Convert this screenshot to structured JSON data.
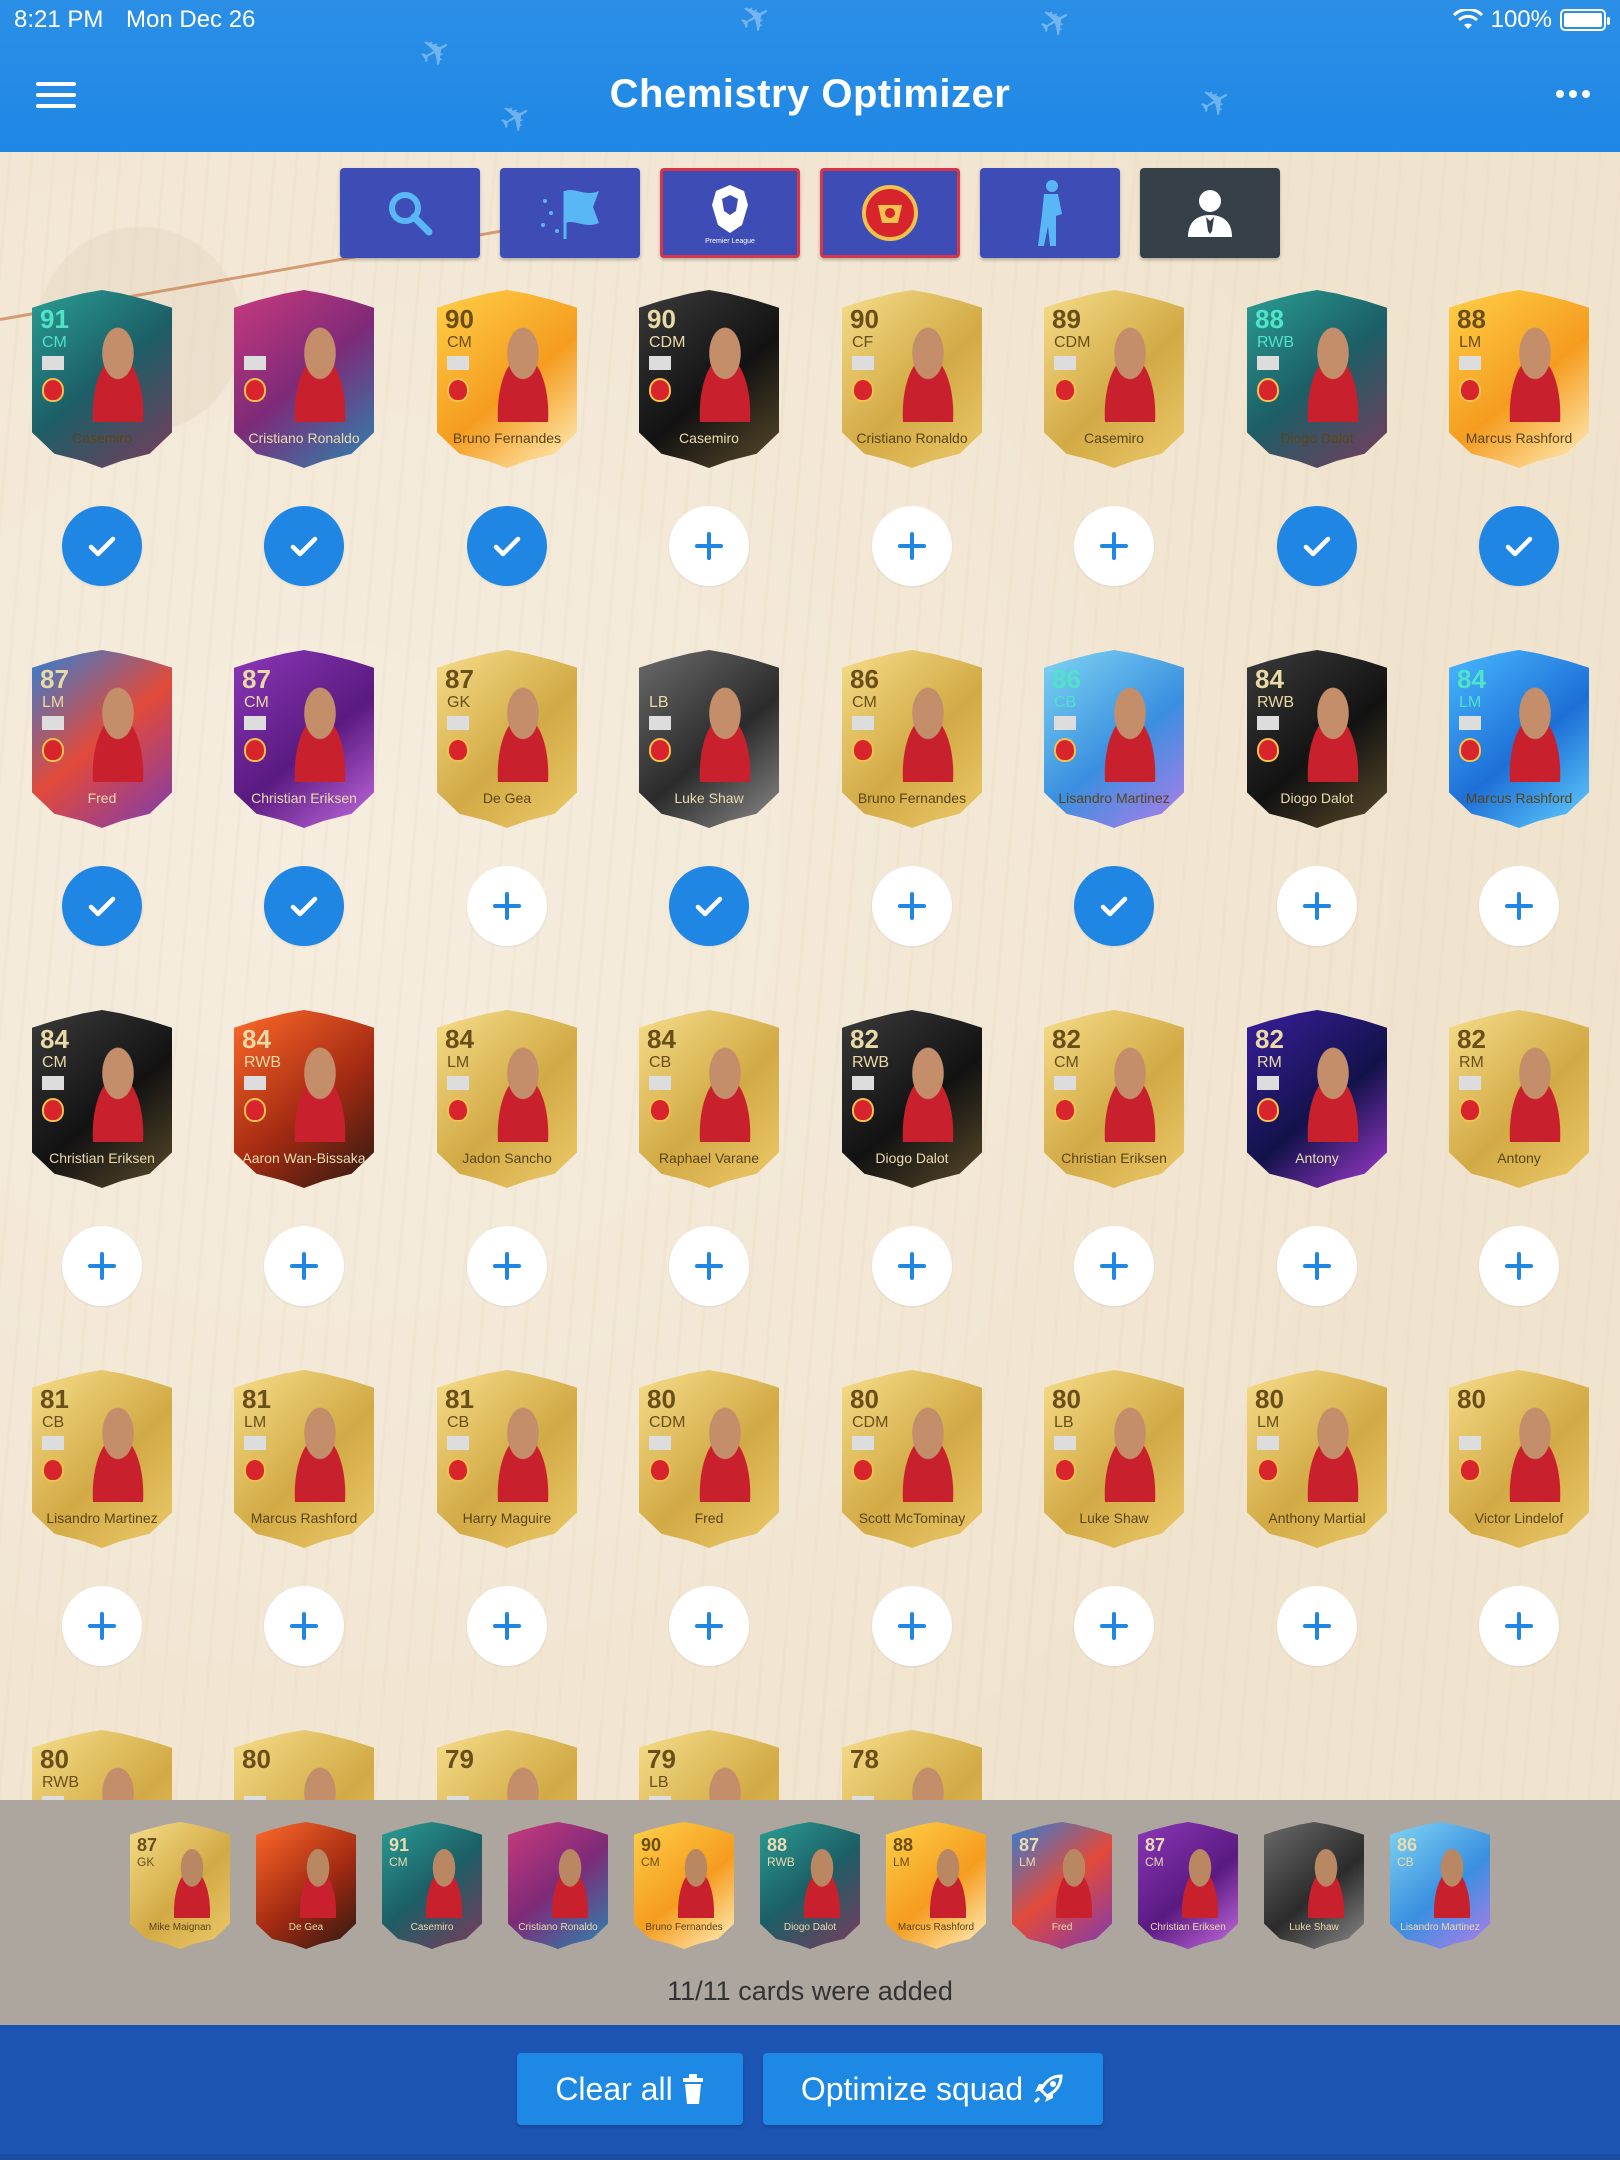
{
  "status_bar": {
    "time": "8:21 PM",
    "date": "Mon Dec 26",
    "battery": "100%"
  },
  "header": {
    "title": "Chemistry Optimizer"
  },
  "filters": [
    {
      "name": "search-filter",
      "icon": "search-icon",
      "selected": false
    },
    {
      "name": "nation-filter",
      "icon": "flag-icon",
      "selected": false
    },
    {
      "name": "league-filter",
      "icon": "premier-league-icon",
      "selected": true
    },
    {
      "name": "club-filter",
      "icon": "manchester-united-icon",
      "selected": true
    },
    {
      "name": "position-filter",
      "icon": "player-icon",
      "selected": false
    },
    {
      "name": "manager-filter",
      "icon": "manager-icon",
      "selected": false
    }
  ],
  "cards": [
    {
      "rating": "91",
      "pos": "CM",
      "name": "Casemiro",
      "style": "teal",
      "added": true
    },
    {
      "rating": "",
      "pos": "",
      "name": "Cristiano Ronaldo",
      "style": "pink",
      "added": true
    },
    {
      "rating": "90",
      "pos": "CM",
      "name": "Bruno Fernandes",
      "style": "orange",
      "added": true
    },
    {
      "rating": "90",
      "pos": "CDM",
      "name": "Casemiro",
      "style": "black",
      "added": false
    },
    {
      "rating": "90",
      "pos": "CF",
      "name": "Cristiano Ronaldo",
      "style": "gold",
      "added": false
    },
    {
      "rating": "89",
      "pos": "CDM",
      "name": "Casemiro",
      "style": "gold",
      "added": false
    },
    {
      "rating": "88",
      "pos": "RWB",
      "name": "Diogo Dalot",
      "style": "teal",
      "added": true
    },
    {
      "rating": "88",
      "pos": "LM",
      "name": "Marcus Rashford",
      "style": "orange",
      "added": true
    },
    {
      "rating": "87",
      "pos": "LM",
      "name": "Fred",
      "style": "fred",
      "added": true
    },
    {
      "rating": "87",
      "pos": "CM",
      "name": "Christian Eriksen",
      "style": "purple",
      "added": true
    },
    {
      "rating": "87",
      "pos": "GK",
      "name": "De Gea",
      "style": "gold",
      "added": false
    },
    {
      "rating": "",
      "pos": "LB",
      "name": "Luke Shaw",
      "style": "grey",
      "added": true
    },
    {
      "rating": "86",
      "pos": "CM",
      "name": "Bruno Fernandes",
      "style": "gold",
      "added": false
    },
    {
      "rating": "86",
      "pos": "CB",
      "name": "Lisandro Martinez",
      "style": "ice",
      "added": true
    },
    {
      "rating": "84",
      "pos": "RWB",
      "name": "Diogo Dalot",
      "style": "black",
      "added": false
    },
    {
      "rating": "84",
      "pos": "LM",
      "name": "Marcus Rashford",
      "style": "blue",
      "added": false
    },
    {
      "rating": "84",
      "pos": "CM",
      "name": "Christian Eriksen",
      "style": "black",
      "added": false
    },
    {
      "rating": "84",
      "pos": "RWB",
      "name": "Aaron Wan-Bissaka",
      "style": "red",
      "added": false
    },
    {
      "rating": "84",
      "pos": "LM",
      "name": "Jadon Sancho",
      "style": "gold",
      "added": false
    },
    {
      "rating": "84",
      "pos": "CB",
      "name": "Raphael Varane",
      "style": "gold",
      "added": false
    },
    {
      "rating": "82",
      "pos": "RWB",
      "name": "Diogo Dalot",
      "style": "black",
      "added": false
    },
    {
      "rating": "82",
      "pos": "CM",
      "name": "Christian Eriksen",
      "style": "gold",
      "added": false
    },
    {
      "rating": "82",
      "pos": "RM",
      "name": "Antony",
      "style": "cosmic",
      "added": false
    },
    {
      "rating": "82",
      "pos": "RM",
      "name": "Antony",
      "style": "gold",
      "added": false
    },
    {
      "rating": "81",
      "pos": "CB",
      "name": "Lisandro Martinez",
      "style": "gold",
      "added": false
    },
    {
      "rating": "81",
      "pos": "LM",
      "name": "Marcus Rashford",
      "style": "gold",
      "added": false
    },
    {
      "rating": "81",
      "pos": "CB",
      "name": "Harry Maguire",
      "style": "gold",
      "added": false
    },
    {
      "rating": "80",
      "pos": "CDM",
      "name": "Fred",
      "style": "gold",
      "added": false
    },
    {
      "rating": "80",
      "pos": "CDM",
      "name": "Scott McTominay",
      "style": "gold",
      "added": false
    },
    {
      "rating": "80",
      "pos": "LB",
      "name": "Luke Shaw",
      "style": "gold",
      "added": false
    },
    {
      "rating": "80",
      "pos": "LM",
      "name": "Anthony Martial",
      "style": "gold",
      "added": false
    },
    {
      "rating": "80",
      "pos": "",
      "name": "Victor Lindelof",
      "style": "gold",
      "added": false
    }
  ],
  "partial_cards": [
    {
      "rating": "80",
      "pos": "RWB"
    },
    {
      "rating": "80",
      "pos": ""
    },
    {
      "rating": "79",
      "pos": ""
    },
    {
      "rating": "79",
      "pos": "LB"
    },
    {
      "rating": "78",
      "pos": ""
    }
  ],
  "tray": {
    "cards": [
      {
        "rating": "87",
        "pos": "GK",
        "name": "Mike Maignan",
        "style": "gold"
      },
      {
        "rating": "",
        "pos": "",
        "name": "De Gea",
        "style": "red"
      },
      {
        "rating": "91",
        "pos": "CM",
        "name": "Casemiro",
        "style": "teal"
      },
      {
        "rating": "",
        "pos": "",
        "name": "Cristiano Ronaldo",
        "style": "pink"
      },
      {
        "rating": "90",
        "pos": "CM",
        "name": "Bruno Fernandes",
        "style": "orange"
      },
      {
        "rating": "88",
        "pos": "RWB",
        "name": "Diogo Dalot",
        "style": "teal"
      },
      {
        "rating": "88",
        "pos": "LM",
        "name": "Marcus Rashford",
        "style": "orange"
      },
      {
        "rating": "87",
        "pos": "LM",
        "name": "Fred",
        "style": "fred"
      },
      {
        "rating": "87",
        "pos": "CM",
        "name": "Christian Eriksen",
        "style": "purple"
      },
      {
        "rating": "",
        "pos": "",
        "name": "Luke Shaw",
        "style": "grey"
      },
      {
        "rating": "86",
        "pos": "CB",
        "name": "Lisandro Martinez",
        "style": "ice"
      }
    ],
    "status": "11/11 cards were added"
  },
  "footer": {
    "clear_label": "Clear all",
    "optimize_label": "Optimize squad"
  },
  "colors": {
    "header": "#1e87e5",
    "toggle_on": "#1f86e3",
    "filter": "#3d4db5",
    "footer": "#1d55b4"
  }
}
